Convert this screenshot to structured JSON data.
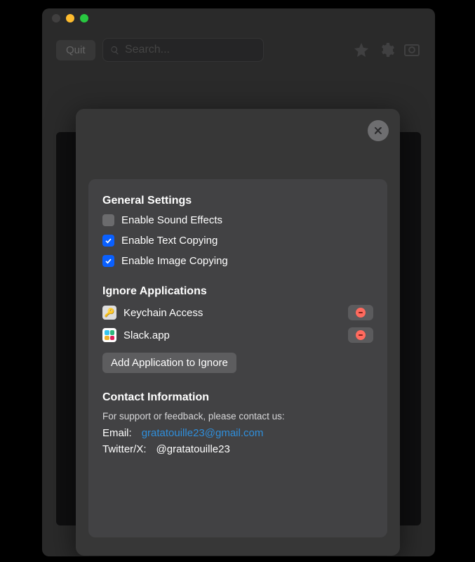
{
  "toolbar": {
    "quit_label": "Quit",
    "search_placeholder": "Search..."
  },
  "settings": {
    "general_title": "General Settings",
    "checks": [
      {
        "label": "Enable Sound Effects",
        "checked": false
      },
      {
        "label": "Enable Text Copying",
        "checked": true
      },
      {
        "label": "Enable Image Copying",
        "checked": true
      }
    ],
    "ignore_title": "Ignore Applications",
    "apps": [
      {
        "name": "Keychain Access"
      },
      {
        "name": "Slack.app"
      }
    ],
    "add_app_label": "Add Application to Ignore",
    "contact_title": "Contact Information",
    "contact_text": "For support or feedback, please contact us:",
    "email_label": "Email:",
    "email_value": "gratatouille23@gmail.com",
    "twitter_label": "Twitter/X:",
    "twitter_value": "@gratatouille23"
  }
}
